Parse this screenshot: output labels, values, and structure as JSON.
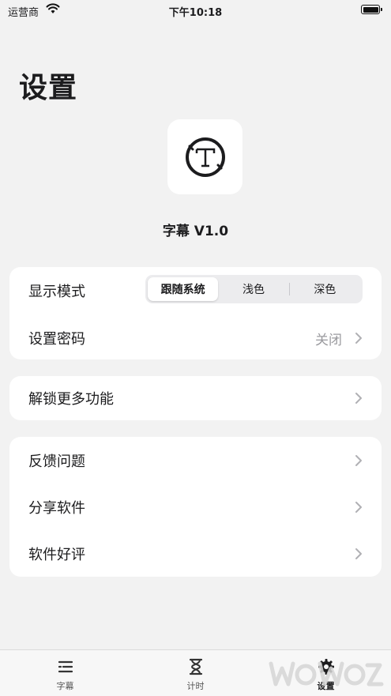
{
  "status_bar": {
    "carrier": "运营商",
    "time": "下午10:18"
  },
  "page": {
    "title": "设置"
  },
  "app": {
    "name": "字幕 V1.0"
  },
  "display_mode": {
    "label": "显示模式",
    "options": [
      "跟随系统",
      "浅色",
      "深色"
    ],
    "selected": "跟随系统"
  },
  "password": {
    "label": "设置密码",
    "value": "关闭"
  },
  "unlock": {
    "label": "解锁更多功能"
  },
  "more_items": [
    "反馈问题",
    "分享软件",
    "软件好评"
  ],
  "tabs": [
    {
      "label": "字幕",
      "icon": "list-icon"
    },
    {
      "label": "计时",
      "icon": "hourglass-icon"
    },
    {
      "label": "设置",
      "icon": "gear-icon",
      "active": true
    }
  ],
  "colors": {
    "background": "#f2f2f2",
    "card": "#ffffff",
    "secondary_text": "#9a9a9e"
  }
}
